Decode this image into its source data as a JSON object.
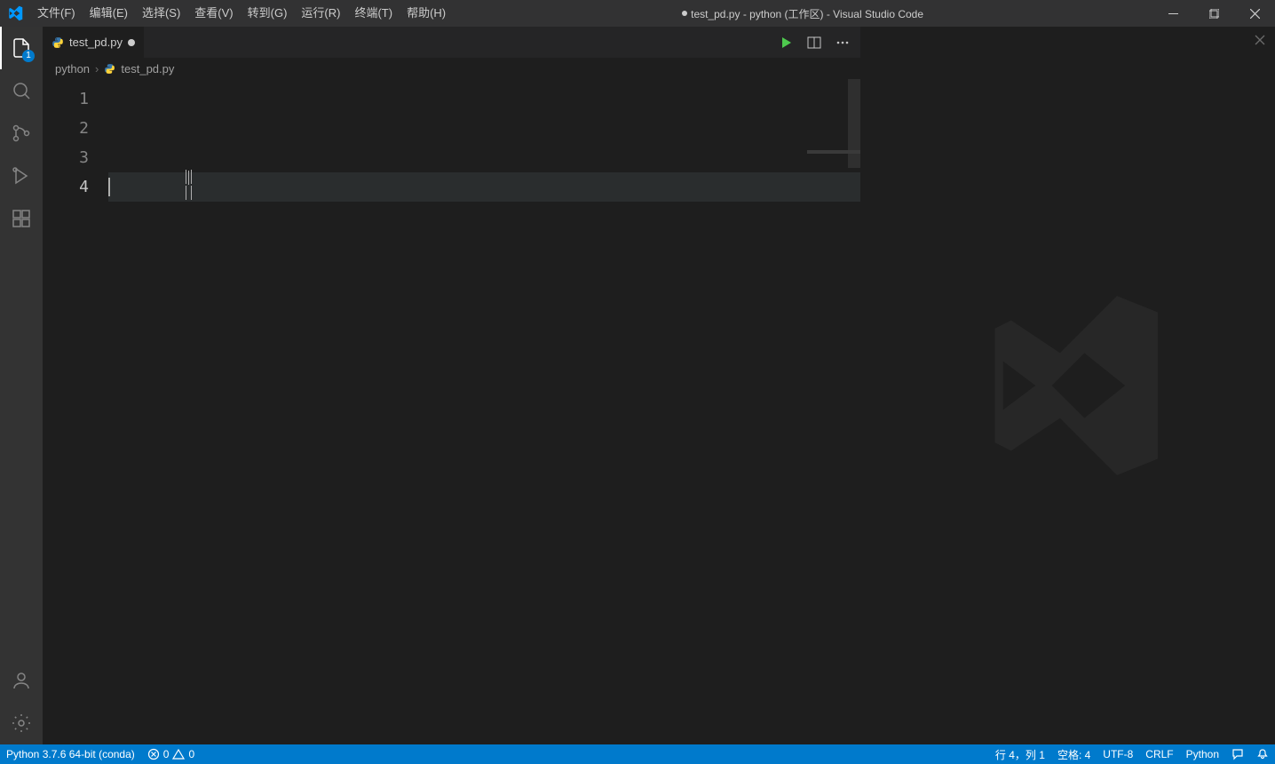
{
  "titlebar": {
    "menus": [
      "文件(F)",
      "编辑(E)",
      "选择(S)",
      "查看(V)",
      "转到(G)",
      "运行(R)",
      "终端(T)",
      "帮助(H)"
    ],
    "title_prefix": "test_pd.py - python (工作区) - Visual Studio Code"
  },
  "activitybar": {
    "badge": "1"
  },
  "tab": {
    "filename": "test_pd.py"
  },
  "breadcrumb": {
    "folder": "python",
    "file": "test_pd.py"
  },
  "editor": {
    "line_numbers": [
      "1",
      "2",
      "3",
      "4"
    ],
    "active_line_index": 3,
    "lines": [
      "",
      "",
      "",
      ""
    ]
  },
  "statusbar": {
    "python_env": "Python 3.7.6 64-bit (conda)",
    "errors": "0",
    "warnings": "0",
    "line_col": "行 4，列 1",
    "spaces": "空格: 4",
    "encoding": "UTF-8",
    "eol": "CRLF",
    "language": "Python"
  }
}
